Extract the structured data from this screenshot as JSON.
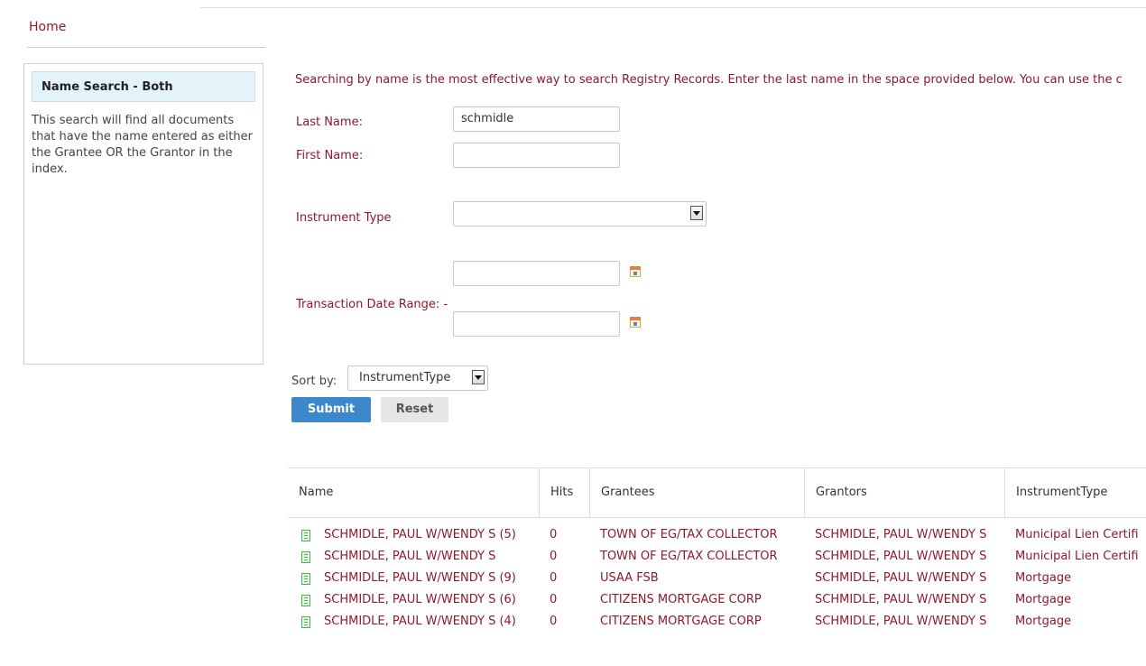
{
  "breadcrumb": {
    "home": "Home"
  },
  "sidebar": {
    "title": "Name Search - Both",
    "description": "This search will find all documents that have the name entered as either the Grantee OR the Grantor in the index."
  },
  "intro": "Searching by name is the most effective way to search Registry Records. Enter the last name in the space provided below. You can use the c",
  "form": {
    "last_name_label": "Last Name:",
    "last_name_value": "schmidle",
    "first_name_label": "First Name:",
    "first_name_value": "",
    "instrument_type_label": "Instrument Type",
    "instrument_type_value": "",
    "date_range_label": "Transaction Date Range:",
    "date_range_sep": "-",
    "date_from": "",
    "date_to": "",
    "sort_label": "Sort by:",
    "sort_value": "InstrumentType",
    "submit_label": "Submit",
    "reset_label": "Reset"
  },
  "table": {
    "columns": [
      "Name",
      "Hits",
      "Grantees",
      "Grantors",
      "InstrumentType"
    ],
    "rows": [
      {
        "name": "SCHMIDLE, PAUL W/WENDY S (5)",
        "hits": "0",
        "grantees": "TOWN OF EG/TAX COLLECTOR",
        "grantors": "SCHMIDLE, PAUL W/WENDY S",
        "type": "Municipal Lien Certifi"
      },
      {
        "name": "SCHMIDLE, PAUL W/WENDY S",
        "hits": "0",
        "grantees": "TOWN OF EG/TAX COLLECTOR",
        "grantors": "SCHMIDLE, PAUL W/WENDY S",
        "type": "Municipal Lien Certifi"
      },
      {
        "name": "SCHMIDLE, PAUL W/WENDY S (9)",
        "hits": "0",
        "grantees": "USAA FSB",
        "grantors": "SCHMIDLE, PAUL W/WENDY S",
        "type": "Mortgage"
      },
      {
        "name": "SCHMIDLE, PAUL W/WENDY S (6)",
        "hits": "0",
        "grantees": "CITIZENS MORTGAGE CORP",
        "grantors": "SCHMIDLE, PAUL W/WENDY S",
        "type": "Mortgage"
      },
      {
        "name": "SCHMIDLE, PAUL W/WENDY S (4)",
        "hits": "0",
        "grantees": "CITIZENS MORTGAGE CORP",
        "grantors": "SCHMIDLE, PAUL W/WENDY S",
        "type": "Mortgage"
      }
    ]
  },
  "colors": {
    "link": "#8b1a2b",
    "primary_button": "#3d87cb",
    "sidebar_header": "#e4f3fa"
  }
}
